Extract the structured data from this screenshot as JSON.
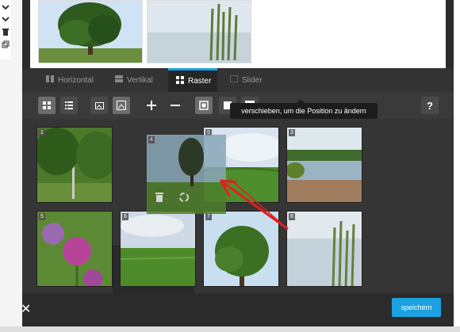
{
  "tabs": {
    "horizontal": "Horizontal",
    "vertical": "Vertikal",
    "grid": "Raster",
    "slider": "Slider"
  },
  "tooltip": "verschieben, um die Position zu ändern",
  "help_label": "?",
  "bottom": {
    "close": "✕",
    "save": "speichern"
  },
  "grid_numbers": [
    "1",
    "4",
    "5",
    "3",
    "5",
    "6",
    "7",
    "8"
  ]
}
